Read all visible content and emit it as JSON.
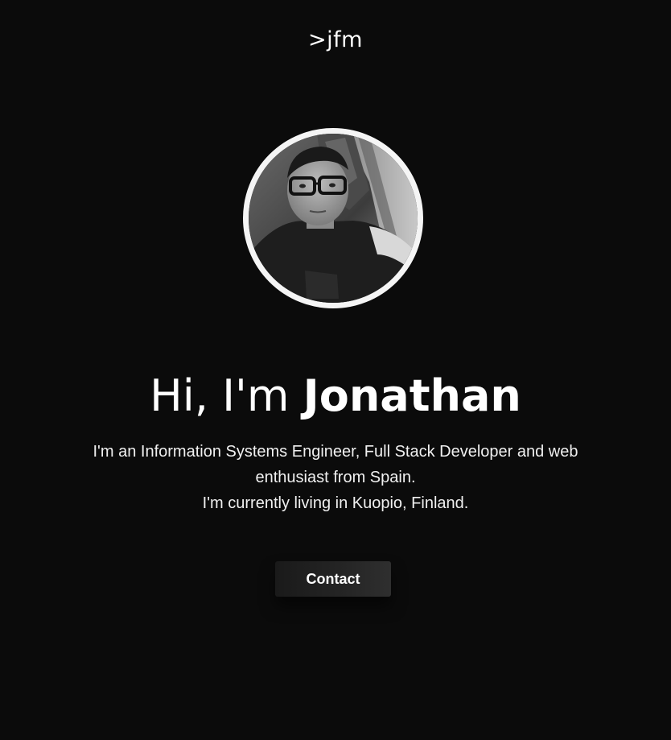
{
  "header": {
    "logo_text": ">jfm"
  },
  "hero": {
    "avatar_alt": "profile photo",
    "greeting_prefix": "Hi, I'm ",
    "greeting_name": "Jonathan",
    "bio_line_1": "I'm an Information Systems Engineer, Full Stack Developer and web enthusiast from Spain.",
    "bio_line_2": "I'm currently living in Kuopio, Finland.",
    "contact_label": "Contact"
  },
  "colors": {
    "background": "#0b0b0b",
    "text": "#ffffff",
    "avatar_border": "#f5f5f5",
    "button_bg": "#222222"
  }
}
